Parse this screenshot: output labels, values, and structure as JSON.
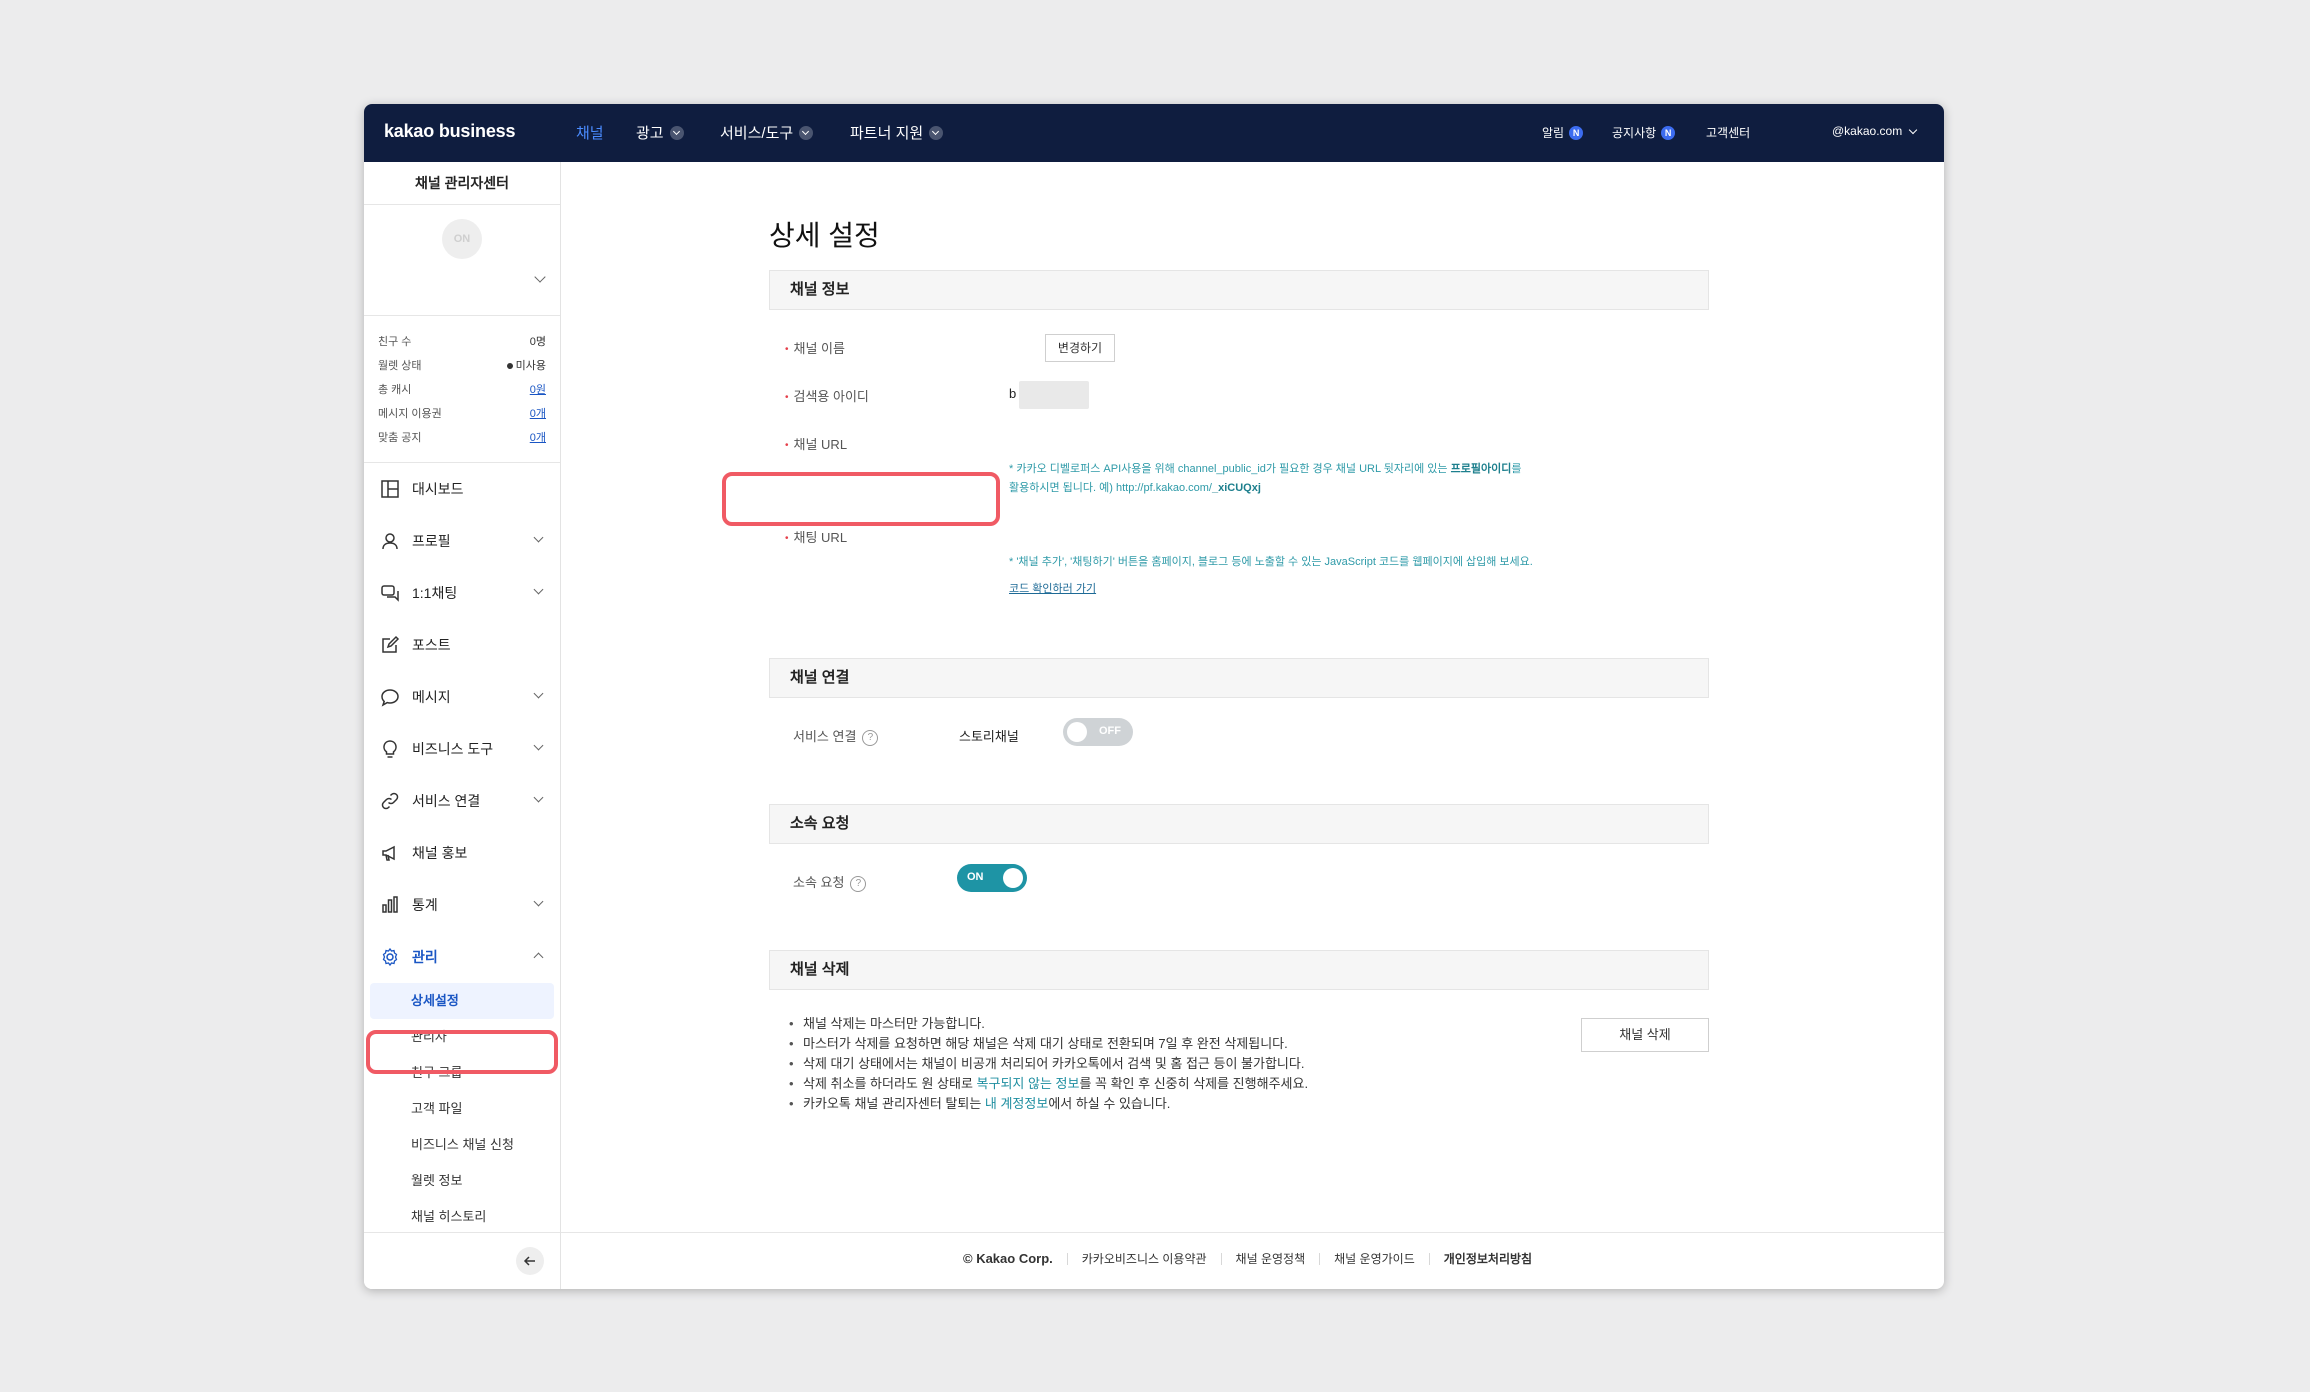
{
  "topnav": {
    "logo": "kakao business",
    "items": [
      "채널",
      "광고",
      "서비스/도구",
      "파트너 지원"
    ],
    "right": {
      "alarm": "알림",
      "notice": "공지사항",
      "badge": "N",
      "support": "고객센터",
      "account": "@kakao.com"
    }
  },
  "sidebar": {
    "title": "채널 관리자센터",
    "avatar_text": "ON",
    "stats": [
      {
        "label": "친구 수",
        "value": "0명"
      },
      {
        "label": "월렛 상태",
        "value": "미사용"
      },
      {
        "label": "총 캐시",
        "value": "0원"
      },
      {
        "label": "메시지 이용권",
        "value": "0개"
      },
      {
        "label": "맞춤 공지",
        "value": "0개"
      }
    ],
    "menu": [
      "대시보드",
      "프로필",
      "1:1채팅",
      "포스트",
      "메시지",
      "비즈니스 도구",
      "서비스 연결",
      "채널 홍보",
      "통계",
      "관리"
    ],
    "sub": [
      "상세설정",
      "관리자",
      "친구 그룹",
      "고객 파일",
      "비즈니스 채널 신청",
      "월렛 정보",
      "채널 히스토리"
    ]
  },
  "main": {
    "title": "상세 설정",
    "info": {
      "head": "채널 정보",
      "name_label": "채널 이름",
      "change_btn": "변경하기",
      "search_id_label": "검색용 아이디",
      "search_id_value": "b",
      "url_label": "채널 URL",
      "url_notice_1_pre": "* 카카오 디벨로퍼스 API사용을 위해 channel_public_id가 필요한 경우 채널 URL 뒷자리에 있는 ",
      "url_notice_1_bold": "프로필아이디",
      "url_notice_1_post": "를",
      "url_notice_2_pre": "활용하시면 됩니다. 예) http://pf.kakao.com/",
      "url_notice_2_bold": "_xiCUQxj",
      "chat_label": "채팅 URL",
      "chat_notice": "* '채널 추가', '채팅하기' 버튼을 홈페이지, 블로그 등에 노출할 수 있는 JavaScript 코드를 웹페이지에 삽입해 보세요.",
      "code_link": "코드 확인하러 가기"
    },
    "connect": {
      "head": "채널 연결",
      "label": "서비스 연결",
      "help": "?",
      "service": "스토리채널",
      "toggle": "OFF"
    },
    "affiliation": {
      "head": "소속 요청",
      "label": "소속 요청",
      "help": "?",
      "toggle": "ON"
    },
    "delete": {
      "head": "채널 삭제",
      "button": "채널 삭제",
      "b1": "채널 삭제는 마스터만 가능합니다.",
      "b2": "마스터가 삭제를 요청하면 해당 채널은 삭제 대기 상태로 전환되며 7일 후 완전 삭제됩니다.",
      "b3": "삭제 대기 상태에서는 채널이 비공개 처리되어 카카오톡에서 검색 및 홈 접근 등이 불가합니다.",
      "b4_pre": "삭제 취소를 하더라도 원 상태로 ",
      "b4_link": "복구되지 않는 정보",
      "b4_post": "를 꼭 확인 후 신중히 삭제를 진행해주세요.",
      "b5_pre": "카카오톡 채널 관리자센터 탈퇴는 ",
      "b5_link": "내 계정정보",
      "b5_post": "에서 하실 수 있습니다."
    }
  },
  "footer": [
    "© Kakao Corp.",
    "카카오비즈니스 이용약관",
    "채널 운영정책",
    "채널 운영가이드",
    "개인정보처리방침"
  ],
  "colors": {
    "nav_bg": "#0f1d3f",
    "accent": "#1a56c4",
    "teal": "#1e94a5",
    "highlight": "#f05a64"
  }
}
